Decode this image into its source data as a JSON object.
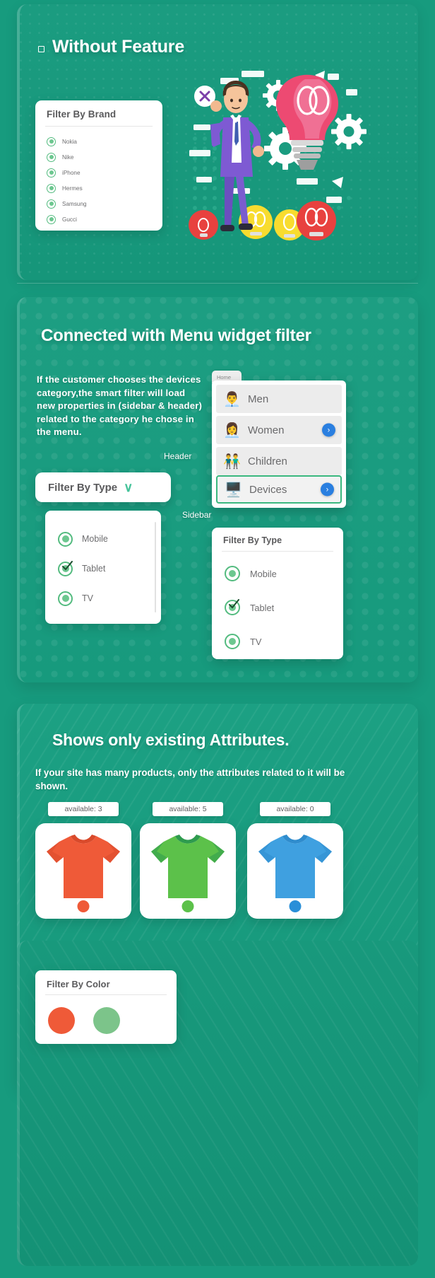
{
  "theme": {
    "bg_green": "#179b7e",
    "panel_green": "#1b9c80",
    "white": "#ffffff",
    "accent_green": "#53bb7f",
    "accent_teal": "#45c39a",
    "blue": "#2a7fe0",
    "yellow": "#f5e02a",
    "text_gray": "#6d6d6f",
    "title_gray": "#59595b"
  },
  "section1": {
    "title": "Without Feature",
    "bullet_icon": "square-bullet-icon",
    "filter_card": {
      "title": "Filter By Brand",
      "options": [
        {
          "label": "Nokia",
          "selected": true
        },
        {
          "label": "Nike",
          "selected": true
        },
        {
          "label": "iPhone",
          "selected": true
        },
        {
          "label": "Hermes",
          "selected": true
        },
        {
          "label": "Samsung",
          "selected": true
        },
        {
          "label": "Gucci",
          "selected": true
        }
      ]
    },
    "illustration": "confused-person-lightbulb-gears-illustration"
  },
  "section2": {
    "title": "Connected with Menu widget filter",
    "paragraph": "If the customer chooses the devices category,the smart filter will load new properties in (sidebar & header) related to the category he chose in the menu.",
    "menu_widget": {
      "tab_label": "Home",
      "items": [
        {
          "label": "Men",
          "icon": "man-avatar-icon",
          "has_arrow": false,
          "active": false
        },
        {
          "label": "Women",
          "icon": "woman-avatar-icon",
          "has_arrow": true,
          "active": false
        },
        {
          "label": "Children",
          "icon": "children-avatar-icon",
          "has_arrow": false,
          "active": false
        },
        {
          "label": "Devices",
          "icon": "computer-icon",
          "has_arrow": true,
          "active": true
        }
      ],
      "arrow_glyph": "›"
    },
    "annotations": {
      "header": "Header",
      "sidebar": "Sidebar"
    },
    "header_filter": {
      "title": "Filter By Type",
      "chevron_glyph": "∨",
      "chevron_icon": "chevron-down-icon"
    },
    "header_filter_list": {
      "options": [
        {
          "label": "Mobile",
          "checked": false
        },
        {
          "label": "Tablet",
          "checked": true
        },
        {
          "label": "TV",
          "checked": false
        }
      ]
    },
    "sidebar_filter": {
      "title": "Filter By Type",
      "options": [
        {
          "label": "Mobile",
          "checked": false
        },
        {
          "label": "Tablet",
          "checked": true
        },
        {
          "label": "TV",
          "checked": false
        }
      ]
    }
  },
  "section3": {
    "title": "Shows only existing Attributes.",
    "paragraph": "If your site has many products, only the attributes related to it will be shown.",
    "products": [
      {
        "badge": "available: 3",
        "shirt_color": "#ef5a38",
        "shirt_color_dark": "#d94a2b",
        "swatch": "#ef5a38"
      },
      {
        "badge": "available: 5",
        "shirt_color": "#5cc14a",
        "shirt_color_dark": "#2e9b4e",
        "swatch": "#5cc14a"
      },
      {
        "badge": "available: 0",
        "shirt_color": "#3fa0e0",
        "shirt_color_dark": "#2f8ccd",
        "swatch": "#2a8fd8"
      }
    ],
    "color_filter": {
      "title": "Filter By Color",
      "swatches": [
        {
          "color": "#ef5a38",
          "name": "red-color-swatch"
        },
        {
          "color": "#7cc48a",
          "name": "green-color-swatch"
        }
      ]
    },
    "chip_icon": "microchip-icon",
    "connector_arrows": "dashed-arrow-connectors"
  }
}
